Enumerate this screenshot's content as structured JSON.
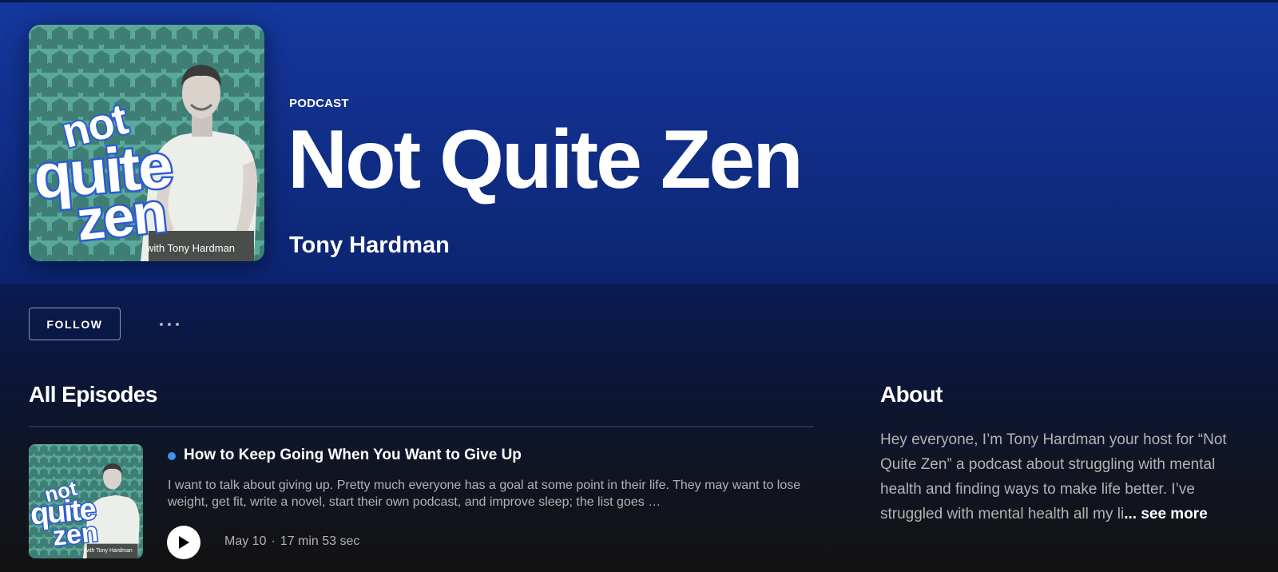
{
  "colors": {
    "header_blue": "#14389e",
    "background": "#121212",
    "new_episode_dot": "#3d91f4",
    "muted_text": "#b3b3b3"
  },
  "cover": {
    "line1": "not",
    "line2": "quite",
    "line3": "zen",
    "byline": "with Tony Hardman"
  },
  "header": {
    "type_label": "PODCAST",
    "title": "Not Quite Zen",
    "author": "Tony Hardman"
  },
  "actions": {
    "follow_label": "FOLLOW",
    "more_icon": "more-horizontal-icon"
  },
  "episodes": {
    "section_title": "All Episodes",
    "items": [
      {
        "title": "How to Keep Going When You Want to Give Up",
        "description": "I want to talk about giving up.  Pretty much everyone has a goal at some point in their life. They may want to lose weight, get fit, write a novel, start their own podcast, and improve sleep; the list goes …",
        "date": "May 10",
        "separator": "·",
        "duration": "17 min 53 sec",
        "play_icon": "play-icon"
      }
    ]
  },
  "about": {
    "section_title": "About",
    "text": "Hey everyone, I’m Tony Hardman your host for “Not Quite Zen” a podcast about struggling with mental health and finding ways to make life better. I’ve struggled with mental health all my li",
    "see_more_label": "... see more"
  }
}
